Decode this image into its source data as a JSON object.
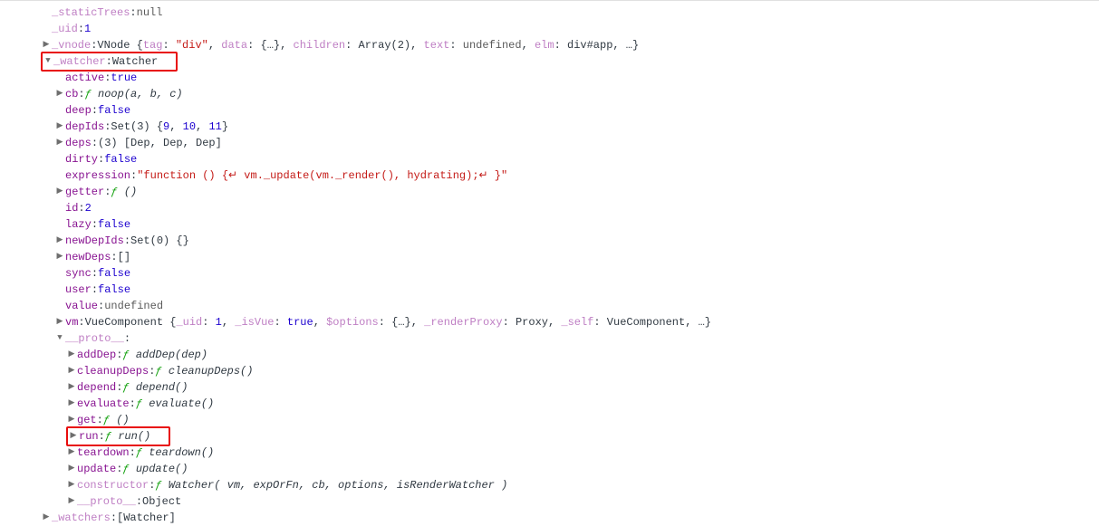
{
  "rows": [
    {
      "indent": 0,
      "arrow": "",
      "key": "_staticTrees",
      "keyClass": "kdim",
      "val": [
        {
          "t": "null",
          "c": "gray"
        }
      ]
    },
    {
      "indent": 0,
      "arrow": "",
      "key": "_uid",
      "keyClass": "kdim",
      "val": [
        {
          "t": "1",
          "c": "num"
        }
      ]
    },
    {
      "indent": 0,
      "arrow": "right",
      "key": "_vnode",
      "keyClass": "kdim",
      "val": [
        {
          "t": "VNode {",
          "c": "obj"
        },
        {
          "t": "tag",
          "c": "kdim"
        },
        {
          "t": ": ",
          "c": "obj"
        },
        {
          "t": "\"div\"",
          "c": "str"
        },
        {
          "t": ", ",
          "c": "obj"
        },
        {
          "t": "data",
          "c": "kdim"
        },
        {
          "t": ": {…}, ",
          "c": "obj"
        },
        {
          "t": "children",
          "c": "kdim"
        },
        {
          "t": ": Array(2), ",
          "c": "obj"
        },
        {
          "t": "text",
          "c": "kdim"
        },
        {
          "t": ": ",
          "c": "obj"
        },
        {
          "t": "undefined",
          "c": "gray"
        },
        {
          "t": ", ",
          "c": "obj"
        },
        {
          "t": "elm",
          "c": "kdim"
        },
        {
          "t": ": div#app, …}",
          "c": "obj"
        }
      ]
    },
    {
      "indent": 0,
      "arrow": "down",
      "key": "_watcher",
      "keyClass": "kdim",
      "val": [
        {
          "t": "Watcher",
          "c": "obj"
        }
      ],
      "boxed": 1
    },
    {
      "indent": 1,
      "arrow": "",
      "key": "active",
      "keyClass": "k",
      "val": [
        {
          "t": "true",
          "c": "kw"
        }
      ]
    },
    {
      "indent": 1,
      "arrow": "right",
      "key": "cb",
      "keyClass": "k",
      "val": [
        {
          "t": "ƒ ",
          "c": "f"
        },
        {
          "t": "noop(a, b, c)",
          "c": "fn"
        }
      ]
    },
    {
      "indent": 1,
      "arrow": "",
      "key": "deep",
      "keyClass": "k",
      "val": [
        {
          "t": "false",
          "c": "kw"
        }
      ]
    },
    {
      "indent": 1,
      "arrow": "right",
      "key": "depIds",
      "keyClass": "k",
      "val": [
        {
          "t": "Set(3) {",
          "c": "obj"
        },
        {
          "t": "9",
          "c": "num"
        },
        {
          "t": ", ",
          "c": "obj"
        },
        {
          "t": "10",
          "c": "num"
        },
        {
          "t": ", ",
          "c": "obj"
        },
        {
          "t": "11",
          "c": "num"
        },
        {
          "t": "}",
          "c": "obj"
        }
      ]
    },
    {
      "indent": 1,
      "arrow": "right",
      "key": "deps",
      "keyClass": "k",
      "val": [
        {
          "t": "(3) [Dep, Dep, Dep]",
          "c": "obj"
        }
      ]
    },
    {
      "indent": 1,
      "arrow": "",
      "key": "dirty",
      "keyClass": "k",
      "val": [
        {
          "t": "false",
          "c": "kw"
        }
      ]
    },
    {
      "indent": 1,
      "arrow": "",
      "key": "expression",
      "keyClass": "k",
      "val": [
        {
          "t": "\"function () {↵      vm._update(vm._render(), hydrating);↵    }\"",
          "c": "str"
        }
      ]
    },
    {
      "indent": 1,
      "arrow": "right",
      "key": "getter",
      "keyClass": "k",
      "val": [
        {
          "t": "ƒ ",
          "c": "f"
        },
        {
          "t": "()",
          "c": "fn"
        }
      ]
    },
    {
      "indent": 1,
      "arrow": "",
      "key": "id",
      "keyClass": "k",
      "val": [
        {
          "t": "2",
          "c": "num"
        }
      ]
    },
    {
      "indent": 1,
      "arrow": "",
      "key": "lazy",
      "keyClass": "k",
      "val": [
        {
          "t": "false",
          "c": "kw"
        }
      ]
    },
    {
      "indent": 1,
      "arrow": "right",
      "key": "newDepIds",
      "keyClass": "k",
      "val": [
        {
          "t": "Set(0) {}",
          "c": "obj"
        }
      ]
    },
    {
      "indent": 1,
      "arrow": "right",
      "key": "newDeps",
      "keyClass": "k",
      "val": [
        {
          "t": "[]",
          "c": "obj"
        }
      ]
    },
    {
      "indent": 1,
      "arrow": "",
      "key": "sync",
      "keyClass": "k",
      "val": [
        {
          "t": "false",
          "c": "kw"
        }
      ]
    },
    {
      "indent": 1,
      "arrow": "",
      "key": "user",
      "keyClass": "k",
      "val": [
        {
          "t": "false",
          "c": "kw"
        }
      ]
    },
    {
      "indent": 1,
      "arrow": "",
      "key": "value",
      "keyClass": "k",
      "val": [
        {
          "t": "undefined",
          "c": "gray"
        }
      ]
    },
    {
      "indent": 1,
      "arrow": "right",
      "key": "vm",
      "keyClass": "k",
      "val": [
        {
          "t": "VueComponent {",
          "c": "obj"
        },
        {
          "t": "_uid",
          "c": "kdim"
        },
        {
          "t": ": ",
          "c": "obj"
        },
        {
          "t": "1",
          "c": "num"
        },
        {
          "t": ", ",
          "c": "obj"
        },
        {
          "t": "_isVue",
          "c": "kdim"
        },
        {
          "t": ": ",
          "c": "obj"
        },
        {
          "t": "true",
          "c": "kw"
        },
        {
          "t": ", ",
          "c": "obj"
        },
        {
          "t": "$options",
          "c": "kdim"
        },
        {
          "t": ": {…}, ",
          "c": "obj"
        },
        {
          "t": "_renderProxy",
          "c": "kdim"
        },
        {
          "t": ": Proxy, ",
          "c": "obj"
        },
        {
          "t": "_self",
          "c": "kdim"
        },
        {
          "t": ": VueComponent, …}",
          "c": "obj"
        }
      ]
    },
    {
      "indent": 1,
      "arrow": "down",
      "key": "__proto__",
      "keyClass": "kdim",
      "val": [
        {
          "t": "",
          "c": "obj"
        }
      ]
    },
    {
      "indent": 2,
      "arrow": "right",
      "key": "addDep",
      "keyClass": "k",
      "val": [
        {
          "t": "ƒ ",
          "c": "f"
        },
        {
          "t": "addDep(dep)",
          "c": "fn"
        }
      ]
    },
    {
      "indent": 2,
      "arrow": "right",
      "key": "cleanupDeps",
      "keyClass": "k",
      "val": [
        {
          "t": "ƒ ",
          "c": "f"
        },
        {
          "t": "cleanupDeps()",
          "c": "fn"
        }
      ]
    },
    {
      "indent": 2,
      "arrow": "right",
      "key": "depend",
      "keyClass": "k",
      "val": [
        {
          "t": "ƒ ",
          "c": "f"
        },
        {
          "t": "depend()",
          "c": "fn"
        }
      ]
    },
    {
      "indent": 2,
      "arrow": "right",
      "key": "evaluate",
      "keyClass": "k",
      "val": [
        {
          "t": "ƒ ",
          "c": "f"
        },
        {
          "t": "evaluate()",
          "c": "fn"
        }
      ]
    },
    {
      "indent": 2,
      "arrow": "right",
      "key": "get",
      "keyClass": "k",
      "val": [
        {
          "t": "ƒ ",
          "c": "f"
        },
        {
          "t": "()",
          "c": "fn"
        }
      ]
    },
    {
      "indent": 2,
      "arrow": "right",
      "key": "run",
      "keyClass": "k",
      "val": [
        {
          "t": "ƒ ",
          "c": "f"
        },
        {
          "t": "run()",
          "c": "fn"
        }
      ],
      "boxed": 2
    },
    {
      "indent": 2,
      "arrow": "right",
      "key": "teardown",
      "keyClass": "k",
      "val": [
        {
          "t": "ƒ ",
          "c": "f"
        },
        {
          "t": "teardown()",
          "c": "fn"
        }
      ]
    },
    {
      "indent": 2,
      "arrow": "right",
      "key": "update",
      "keyClass": "k",
      "val": [
        {
          "t": "ƒ ",
          "c": "f"
        },
        {
          "t": "update()",
          "c": "fn"
        }
      ]
    },
    {
      "indent": 2,
      "arrow": "right",
      "key": "constructor",
      "keyClass": "kdim",
      "val": [
        {
          "t": "ƒ ",
          "c": "f"
        },
        {
          "t": "Watcher( vm, expOrFn, cb, options, isRenderWatcher )",
          "c": "fn"
        }
      ]
    },
    {
      "indent": 2,
      "arrow": "right",
      "key": "__proto__",
      "keyClass": "kdim",
      "val": [
        {
          "t": "Object",
          "c": "obj"
        }
      ]
    },
    {
      "indent": 0,
      "arrow": "right",
      "key": "_watchers",
      "keyClass": "kdim",
      "val": [
        {
          "t": "[Watcher]",
          "c": "obj"
        }
      ]
    }
  ],
  "glyphs": {
    "right": "▶",
    "down": "▼"
  }
}
